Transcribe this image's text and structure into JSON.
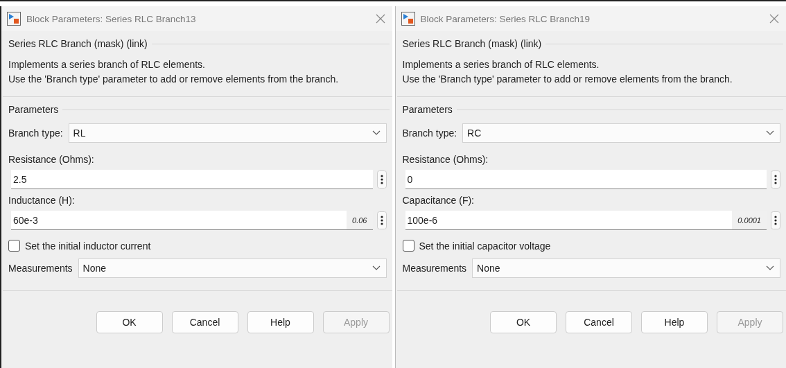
{
  "dialogs": [
    {
      "title": "Block Parameters: Series RLC Branch13",
      "mask_group": "Series RLC Branch (mask) (link)",
      "description": [
        "Implements a series branch of RLC elements.",
        "Use the 'Branch type' parameter to add or remove elements from the branch."
      ],
      "params_group": "Parameters",
      "params": [
        {
          "kind": "dropdown",
          "label": "Branch type:",
          "value": "RL"
        },
        {
          "kind": "field",
          "label": "Resistance (Ohms):",
          "value": "2.5"
        },
        {
          "kind": "field",
          "label": "Inductance (H):",
          "value": "60e-3",
          "evaluated": "0.06"
        },
        {
          "kind": "checkbox",
          "label": "Set the initial inductor current",
          "checked": false
        },
        {
          "kind": "dropdown",
          "label": "Measurements",
          "value": "None"
        }
      ],
      "buttons": [
        {
          "label": "OK",
          "disabled": false
        },
        {
          "label": "Cancel",
          "disabled": false
        },
        {
          "label": "Help",
          "disabled": false
        },
        {
          "label": "Apply",
          "disabled": true
        }
      ]
    },
    {
      "title": "Block Parameters: Series RLC Branch19",
      "mask_group": "Series RLC Branch (mask) (link)",
      "description": [
        "Implements a series branch of RLC elements.",
        "Use the 'Branch type' parameter to add or remove elements from the branch."
      ],
      "params_group": "Parameters",
      "params": [
        {
          "kind": "dropdown",
          "label": "Branch type:",
          "value": "RC"
        },
        {
          "kind": "field",
          "label": "Resistance (Ohms):",
          "value": "0"
        },
        {
          "kind": "field",
          "label": "Capacitance (F):",
          "value": "100e-6",
          "evaluated": "0.0001"
        },
        {
          "kind": "checkbox",
          "label": "Set the initial capacitor voltage",
          "checked": false
        },
        {
          "kind": "dropdown",
          "label": "Measurements",
          "value": "None"
        }
      ],
      "buttons": [
        {
          "label": "OK",
          "disabled": false
        },
        {
          "label": "Cancel",
          "disabled": false
        },
        {
          "label": "Help",
          "disabled": false
        },
        {
          "label": "Apply",
          "disabled": true
        }
      ]
    }
  ]
}
